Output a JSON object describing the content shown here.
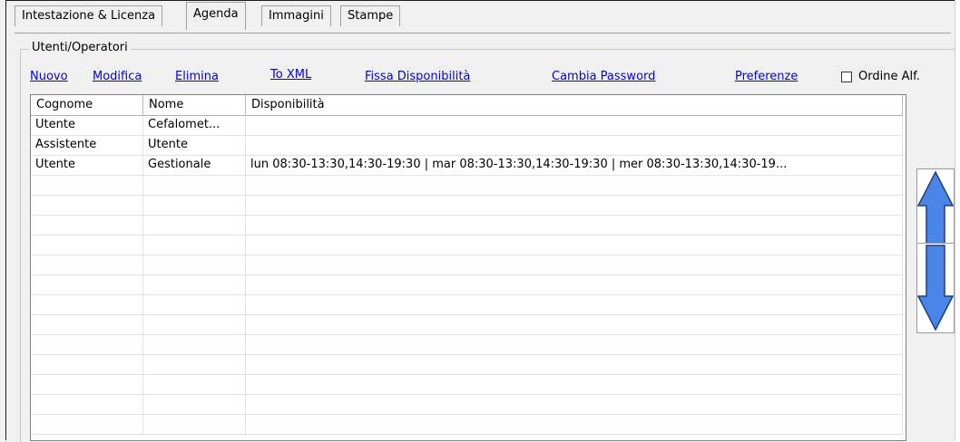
{
  "tabs": [
    {
      "label": "Intestazione & Licenza",
      "active": false
    },
    {
      "label": "Agenda",
      "active": true
    },
    {
      "label": "Immagini",
      "active": false
    },
    {
      "label": "Stampe",
      "active": false
    }
  ],
  "group": {
    "title": "Utenti/Operatori"
  },
  "toolbar": {
    "nuovo": "Nuovo",
    "modifica": "Modifica",
    "elimina": "Elimina",
    "to_xml": "To XML",
    "fissa_disponibilita": "Fissa Disponibilità",
    "cambia_password": "Cambia Password",
    "preferenze": "Preferenze",
    "ordine_alf_label": "Ordine Alf.",
    "ordine_alf_checked": false
  },
  "table": {
    "columns": [
      "Cognome",
      "Nome",
      "Disponibilità"
    ],
    "rows": [
      {
        "cognome": "Utente",
        "nome": "Cefalomet...",
        "disponibilita": ""
      },
      {
        "cognome": "Assistente",
        "nome": "Utente",
        "disponibilita": ""
      },
      {
        "cognome": "Utente",
        "nome": "Gestionale",
        "disponibilita": "lun 08:30-13:30,14:30-19:30 | mar 08:30-13:30,14:30-19:30 | mer 08:30-13:30,14:30-19..."
      }
    ]
  },
  "buttons": {
    "up_icon": "arrow-up-icon",
    "down_icon": "arrow-down-icon"
  },
  "colors": {
    "link": "#0000ee",
    "arrow": "#4a86e8"
  }
}
